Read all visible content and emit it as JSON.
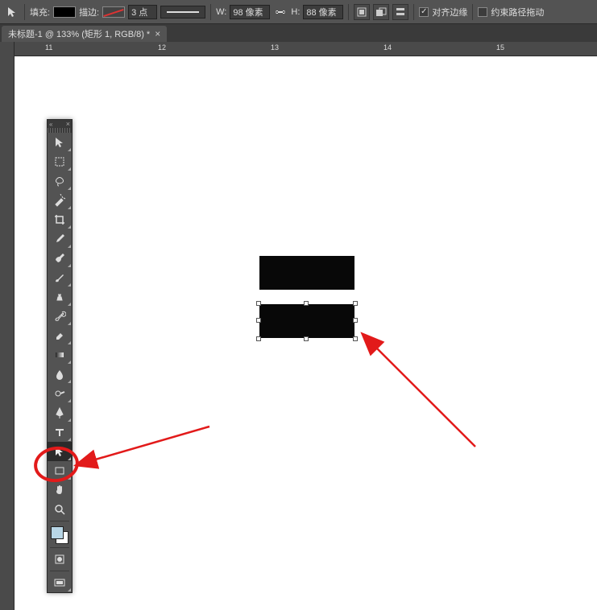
{
  "optionsBar": {
    "fillLabel": "填充:",
    "strokeLabel": "描边:",
    "strokeWidth": "3 点",
    "widthLabel": "W:",
    "widthValue": "98 像素",
    "heightLabel": "H:",
    "heightValue": "88 像素",
    "alignEdgesLabel": "对齐边缘",
    "constrainLabel": "约束路径拖动"
  },
  "tab": {
    "title": "未标题-1 @ 133% (矩形 1, RGB/8) *"
  },
  "ruler": {
    "ticks": [
      "11",
      "12",
      "13",
      "14",
      "15"
    ]
  },
  "tools": {
    "items": [
      "move-tool",
      "marquee-tool",
      "lasso-tool",
      "magic-wand-tool",
      "crop-tool",
      "eyedropper-tool",
      "healing-brush-tool",
      "brush-tool",
      "clone-stamp-tool",
      "history-brush-tool",
      "eraser-tool",
      "gradient-tool",
      "blur-tool",
      "dodge-tool",
      "pen-tool",
      "type-tool",
      "path-selection-tool",
      "rectangle-tool",
      "hand-tool",
      "zoom-tool"
    ]
  }
}
